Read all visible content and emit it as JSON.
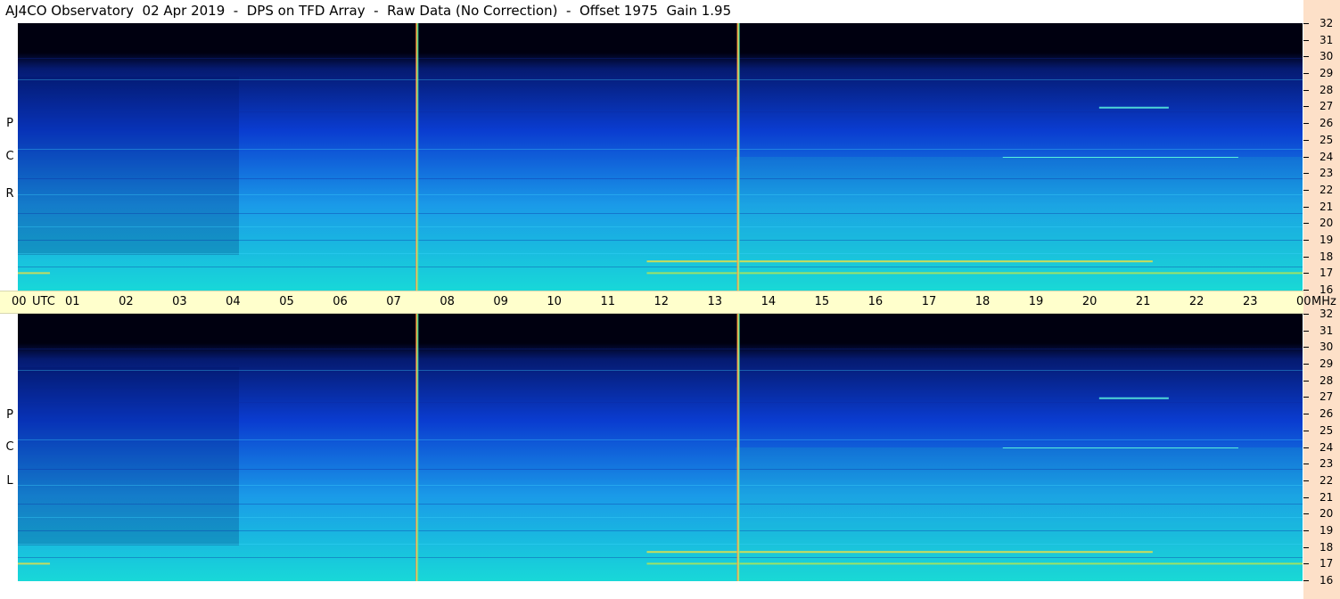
{
  "header": {
    "title": "AJ4CO Observatory  02 Apr 2019  -  DPS on TFD Array  -  Raw Data (No Correction)  -  Offset 1975  Gain 1.95"
  },
  "chart_data": [
    {
      "type": "heatmap",
      "panel": "RCP",
      "side_label": [
        "R",
        "C",
        "P"
      ],
      "x_unit": "UTC",
      "x_ticks": [
        "00",
        "01",
        "02",
        "03",
        "04",
        "05",
        "06",
        "07",
        "08",
        "09",
        "10",
        "11",
        "12",
        "13",
        "14",
        "15",
        "16",
        "17",
        "18",
        "19",
        "20",
        "21",
        "22",
        "23",
        "00"
      ],
      "xlim": [
        0,
        24
      ],
      "y_unit": "MHz",
      "y_ticks": [
        "32",
        "31",
        "30",
        "29",
        "28",
        "27",
        "26",
        "25",
        "24",
        "23",
        "22",
        "21",
        "20",
        "19",
        "18",
        "17",
        "16"
      ],
      "ylim": [
        16,
        32
      ],
      "markers_utc": [
        7.45,
        13.45
      ],
      "colors": {
        "low": "#000010",
        "mid": "#0a3cd0",
        "high": "#18d8d8",
        "hot": "#f0e040"
      }
    },
    {
      "type": "heatmap",
      "panel": "LCP",
      "side_label": [
        "L",
        "C",
        "P"
      ],
      "x_unit": "UTC",
      "x_ticks": [
        "00",
        "01",
        "02",
        "03",
        "04",
        "05",
        "06",
        "07",
        "08",
        "09",
        "10",
        "11",
        "12",
        "13",
        "14",
        "15",
        "16",
        "17",
        "18",
        "19",
        "20",
        "21",
        "22",
        "23",
        "00"
      ],
      "xlim": [
        0,
        24
      ],
      "y_unit": "MHz",
      "y_ticks": [
        "32",
        "31",
        "30",
        "29",
        "28",
        "27",
        "26",
        "25",
        "24",
        "23",
        "22",
        "21",
        "20",
        "19",
        "18",
        "17",
        "16"
      ],
      "ylim": [
        16,
        32
      ],
      "markers_utc": [
        7.45,
        13.45
      ],
      "colors": {
        "low": "#000010",
        "mid": "#0a3cd0",
        "high": "#18d8d8",
        "hot": "#f0e040"
      }
    }
  ],
  "axis": {
    "utc_word": "UTC",
    "mhz_word": "MHz"
  }
}
